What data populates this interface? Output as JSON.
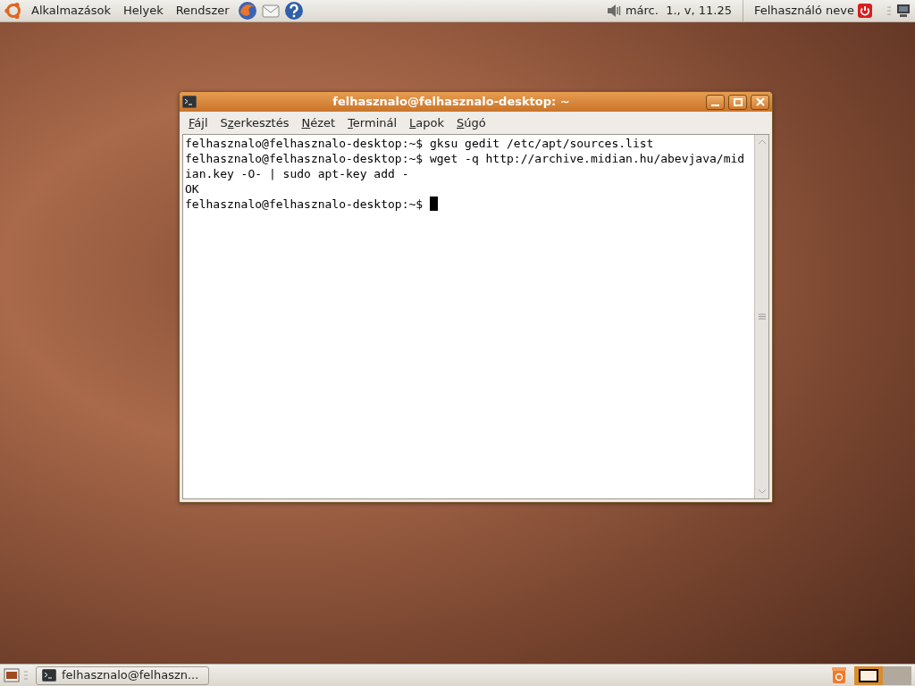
{
  "top_panel": {
    "menus": [
      "Alkalmazások",
      "Helyek",
      "Rendszer"
    ],
    "clock": "márc.  1., v, 11.25",
    "user": "Felhasználó neve"
  },
  "window": {
    "title": "felhasznalo@felhasznalo-desktop: ~",
    "active": true,
    "menu": [
      {
        "parts": [
          {
            "text": "F",
            "underlined": true
          },
          {
            "text": "ájl",
            "underlined": false
          }
        ]
      },
      {
        "parts": [
          {
            "text": "S",
            "underlined": false
          },
          {
            "text": "z",
            "underlined": true
          },
          {
            "text": "erkesztés",
            "underlined": false
          }
        ]
      },
      {
        "parts": [
          {
            "text": "N",
            "underlined": true
          },
          {
            "text": "ézet",
            "underlined": false
          }
        ]
      },
      {
        "parts": [
          {
            "text": "T",
            "underlined": true
          },
          {
            "text": "erminál",
            "underlined": false
          }
        ]
      },
      {
        "parts": [
          {
            "text": "L",
            "underlined": true
          },
          {
            "text": "apok",
            "underlined": false
          }
        ]
      },
      {
        "parts": [
          {
            "text": "S",
            "underlined": true
          },
          {
            "text": "úgó",
            "underlined": false
          }
        ]
      }
    ],
    "terminal_lines": [
      {
        "text": "felhasznalo@felhasznalo-desktop:~$ gksu gedit /etc/apt/sources.list",
        "cursor": false
      },
      {
        "text": "felhasznalo@felhasznalo-desktop:~$ wget -q http://archive.midian.hu/abevjava/mid",
        "cursor": false
      },
      {
        "text": "ian.key -O- | sudo apt-key add -",
        "cursor": false
      },
      {
        "text": "OK",
        "cursor": false
      },
      {
        "text": "felhasznalo@felhasznalo-desktop:~$ ",
        "cursor": true
      }
    ]
  },
  "bottom_panel": {
    "tasks": [
      {
        "label": "felhasznalo@felhaszn...",
        "selected": false
      }
    ],
    "workspaces": [
      {
        "selected": true
      },
      {
        "selected": false
      }
    ]
  }
}
